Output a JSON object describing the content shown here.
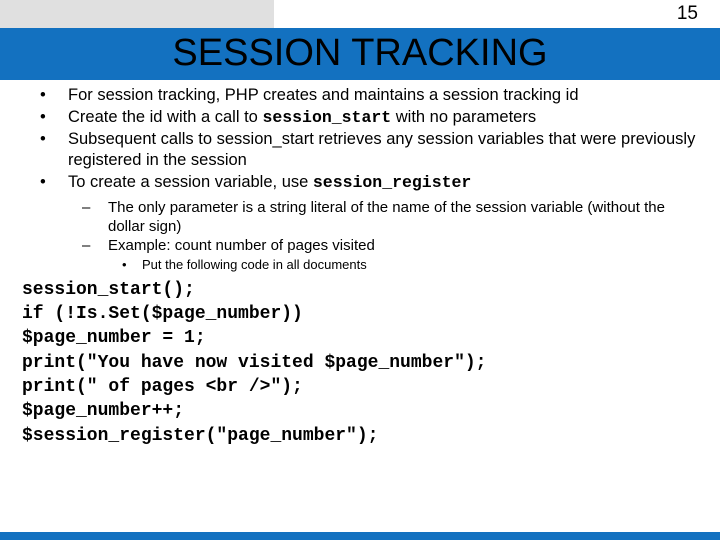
{
  "page_number": "15",
  "title": "SESSION TRACKING",
  "bullets": {
    "b1": "For session tracking, PHP creates and maintains a session tracking id",
    "b2a": "Create the id with a call to ",
    "b2code": "session_start",
    "b2b": " with no parameters",
    "b3": "Subsequent calls to session_start retrieves any session variables that were previously registered in the session",
    "b4a": "To create a session variable, use ",
    "b4code": "session_register"
  },
  "sub": {
    "s1": "The only parameter is a string literal of the name of the session variable (without the dollar sign)",
    "s2": "Example: count number of pages visited"
  },
  "subsub": {
    "ss1": "Put the following code in all documents"
  },
  "code": {
    "l1": "session_start();",
    "l2": "if (!Is.Set($page_number))",
    "l3": "$page_number = 1;",
    "l4": "print(\"You have now visited $page_number\");",
    "l5": "print(\" of pages <br />\");",
    "l6": "$page_number++;",
    "l7": "$session_register(\"page_number\");"
  }
}
